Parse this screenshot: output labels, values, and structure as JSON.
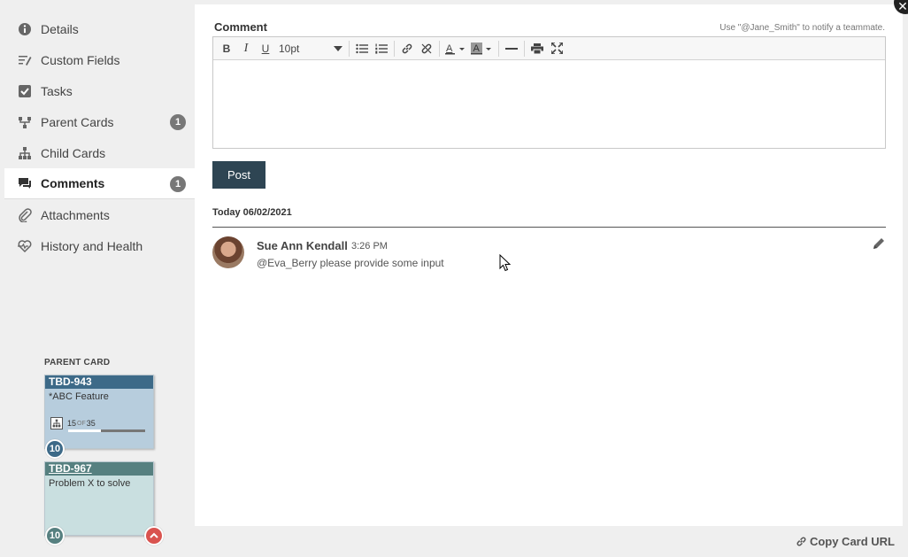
{
  "sidebar": {
    "items": [
      {
        "label": "Details",
        "icon": "info-icon"
      },
      {
        "label": "Custom Fields",
        "icon": "custom-fields-icon"
      },
      {
        "label": "Tasks",
        "icon": "checkbox-icon"
      },
      {
        "label": "Parent Cards",
        "icon": "parent-cards-icon",
        "badge": "1"
      },
      {
        "label": "Child Cards",
        "icon": "child-cards-icon"
      },
      {
        "label": "Comments",
        "icon": "comments-icon",
        "badge": "1",
        "active": true
      },
      {
        "label": "Attachments",
        "icon": "paperclip-icon"
      },
      {
        "label": "History and Health",
        "icon": "heart-icon"
      }
    ]
  },
  "parent_section": {
    "label": "PARENT CARD",
    "cards": [
      {
        "id": "TBD-943",
        "title": "*ABC Feature",
        "progress_done": "15",
        "progress_of": "OF",
        "progress_total": "35",
        "progress_fraction": 0.43,
        "count": "10"
      },
      {
        "id": "TBD-967",
        "title": "Problem X to solve",
        "count": "10"
      }
    ]
  },
  "comment_form": {
    "label": "Comment",
    "hint": "Use \"@Jane_Smith\" to notify a teammate.",
    "font_size": "10pt",
    "post_label": "Post"
  },
  "comments": {
    "date_label": "Today 06/02/2021",
    "items": [
      {
        "author": "Sue Ann Kendall",
        "time": "3:26 PM",
        "text": "@Eva_Berry please provide some input"
      }
    ]
  },
  "footer": {
    "copy_url_label": "Copy Card URL"
  },
  "colors": {
    "post_button": "#2e4553",
    "card1_header": "#3d6a88",
    "card2_header": "#568080",
    "alert": "#d9534f"
  }
}
